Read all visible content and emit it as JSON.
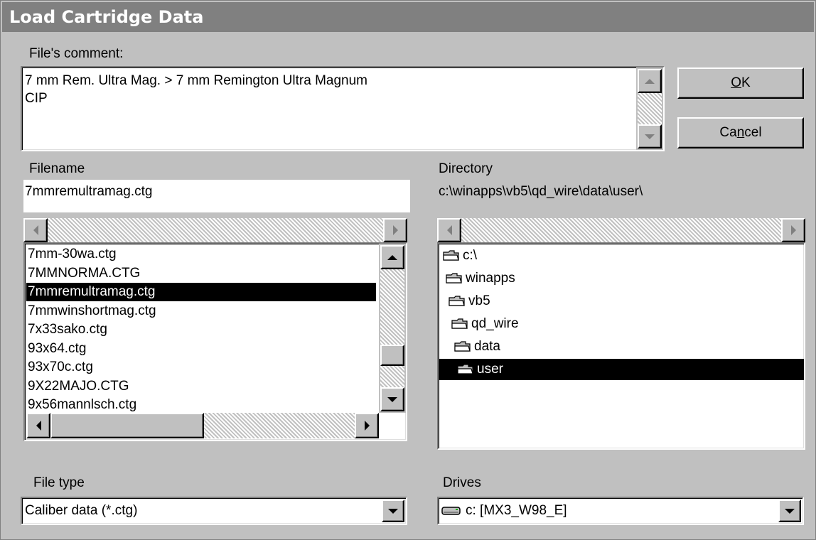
{
  "dialog": {
    "title": "Load Cartridge Data"
  },
  "comment": {
    "label": "File's comment:",
    "lines": [
      "7 mm Rem. Ultra Mag. > 7 mm Remington Ultra Magnum",
      "CIP"
    ]
  },
  "buttons": {
    "ok_mnemonic": "O",
    "ok_rest": "K",
    "cancel_pre": "Ca",
    "cancel_mnemonic": "n",
    "cancel_post": "cel"
  },
  "filename": {
    "label": "Filename",
    "value": "7mmremultramag.ctg",
    "files": [
      "7mm-30wa.ctg",
      "7MMNORMA.CTG",
      "7mmremultramag.ctg",
      "7mmwinshortmag.ctg",
      "7x33sako.ctg",
      "93x64.ctg",
      "93x70c.ctg",
      "9X22MAJO.CTG",
      "9x56mannlsch.ctg"
    ],
    "selected_index": 2
  },
  "directory": {
    "label": "Directory",
    "path": "c:\\winapps\\vb5\\qd_wire\\data\\user\\",
    "folders": [
      "c:\\",
      "winapps",
      "vb5",
      "qd_wire",
      "data",
      "user"
    ],
    "selected_index": 5
  },
  "file_type": {
    "label": "File type",
    "value": "Caliber data (*.ctg)"
  },
  "drives": {
    "label": "Drives",
    "value": "c: [MX3_W98_E]"
  }
}
